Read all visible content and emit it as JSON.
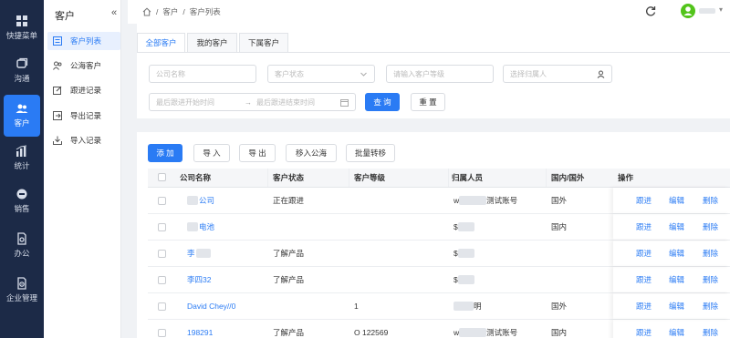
{
  "rail": [
    {
      "label": "快捷菜单",
      "icon": "grid-icon"
    },
    {
      "label": "沟通",
      "icon": "chat-icon"
    },
    {
      "label": "客户",
      "icon": "users-icon",
      "active": true
    },
    {
      "label": "统计",
      "icon": "chart-icon"
    },
    {
      "label": "销售",
      "icon": "sales-icon"
    },
    {
      "label": "办公",
      "icon": "office-icon"
    },
    {
      "label": "企业管理",
      "icon": "settings-icon"
    }
  ],
  "subnav": {
    "title": "客户",
    "collapse": "«",
    "items": [
      {
        "label": "客户列表",
        "icon": "list-icon",
        "active": true
      },
      {
        "label": "公海客户",
        "icon": "people-icon"
      },
      {
        "label": "跟进记录",
        "icon": "edit-icon"
      },
      {
        "label": "导出记录",
        "icon": "export-icon"
      },
      {
        "label": "导入记录",
        "icon": "import-icon"
      }
    ]
  },
  "breadcrumb": {
    "home_icon": "home-icon",
    "sep": "/",
    "level1": "客户",
    "level2": "客户列表"
  },
  "tabs": [
    "全部客户",
    "我的客户",
    "下属客户"
  ],
  "filters": {
    "company_placeholder": "公司名称",
    "status_placeholder": "客户状态",
    "level_placeholder": "请输入客户等级",
    "owner_placeholder": "选择归属人",
    "date_start_placeholder": "最后跟进开始时间",
    "date_arrow": "→",
    "date_end_placeholder": "最后跟进结束时间",
    "query_label": "查 询",
    "reset_label": "重 置"
  },
  "actions": {
    "add": "添 加",
    "import": "导 入",
    "export": "导 出",
    "move_pool": "移入公海",
    "batch_transfer": "批量转移"
  },
  "table": {
    "headers": [
      "公司名称",
      "客户状态",
      "客户等级",
      "归属人员",
      "国内/国外",
      "操作"
    ],
    "rows": [
      {
        "name": "公司",
        "status": "正在跟进",
        "level": "",
        "owner_pre": "w",
        "owner": "测试账号",
        "region": "国外"
      },
      {
        "name": "电池",
        "status": "",
        "level": "",
        "owner_pre": "$",
        "owner": "",
        "region": "国内"
      },
      {
        "name": "李",
        "status": "了解产品",
        "level": "",
        "owner_pre": "$",
        "owner": "",
        "region": ""
      },
      {
        "name": "李四32",
        "status": "了解产品",
        "level": "",
        "owner_pre": "$",
        "owner": "",
        "region": ""
      },
      {
        "name": "David Chey//0",
        "status": "",
        "level": "1",
        "owner_pre": "",
        "owner": "明",
        "region": "国外"
      },
      {
        "name": "198291",
        "status": "了解产品",
        "level": "O 122569",
        "owner_pre": "w",
        "owner": "测试账号",
        "region": "国内"
      }
    ],
    "op_follow": "跟进",
    "op_edit": "编辑",
    "op_delete": "删除"
  },
  "colors": {
    "accent": "#2a7bf4",
    "rail_bg": "#1c2a47",
    "avatar": "#52c41a"
  }
}
